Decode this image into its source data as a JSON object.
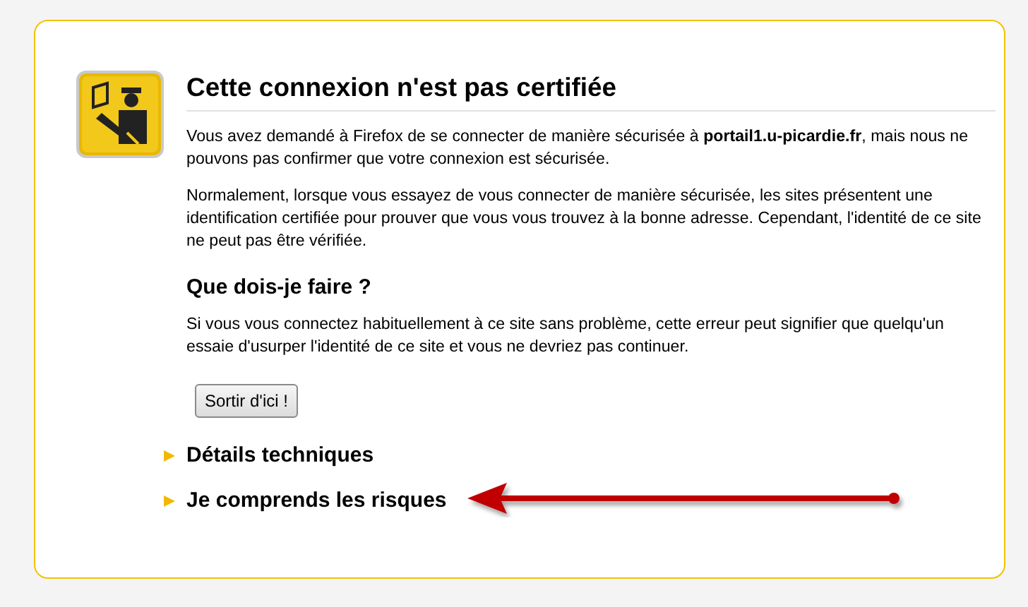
{
  "title": "Cette connexion n'est pas certifiée",
  "paragraphs": [
    "Vous avez demandé à Firefox de se connecter de manière sécurisée à **portail1.u-picardie.fr**, mais nous ne pouvons pas confirmer que votre connexion est sécurisée.",
    "Normalement, lorsque vous essayez de vous connecter de manière sécurisée, les sites présentent une identification certifiée pour prouver que vous vous trouvez à la bonne adresse. Cependant, l'identité de ce site ne peut pas être vérifiée."
  ],
  "section_heading": "Que dois-je faire ?",
  "section_text": "Si vous vous connectez habituellement à ce site sans problème, cette erreur peut signifier que quelqu'un essaie d'usurper l'identité de ce site et vous ne devriez pas continuer.",
  "button": "Sortir d'ici !",
  "expanders": [
    {
      "label": "Détails techniques",
      "expanded": false
    },
    {
      "label": "Je comprends les risques",
      "expanded": false
    }
  ]
}
